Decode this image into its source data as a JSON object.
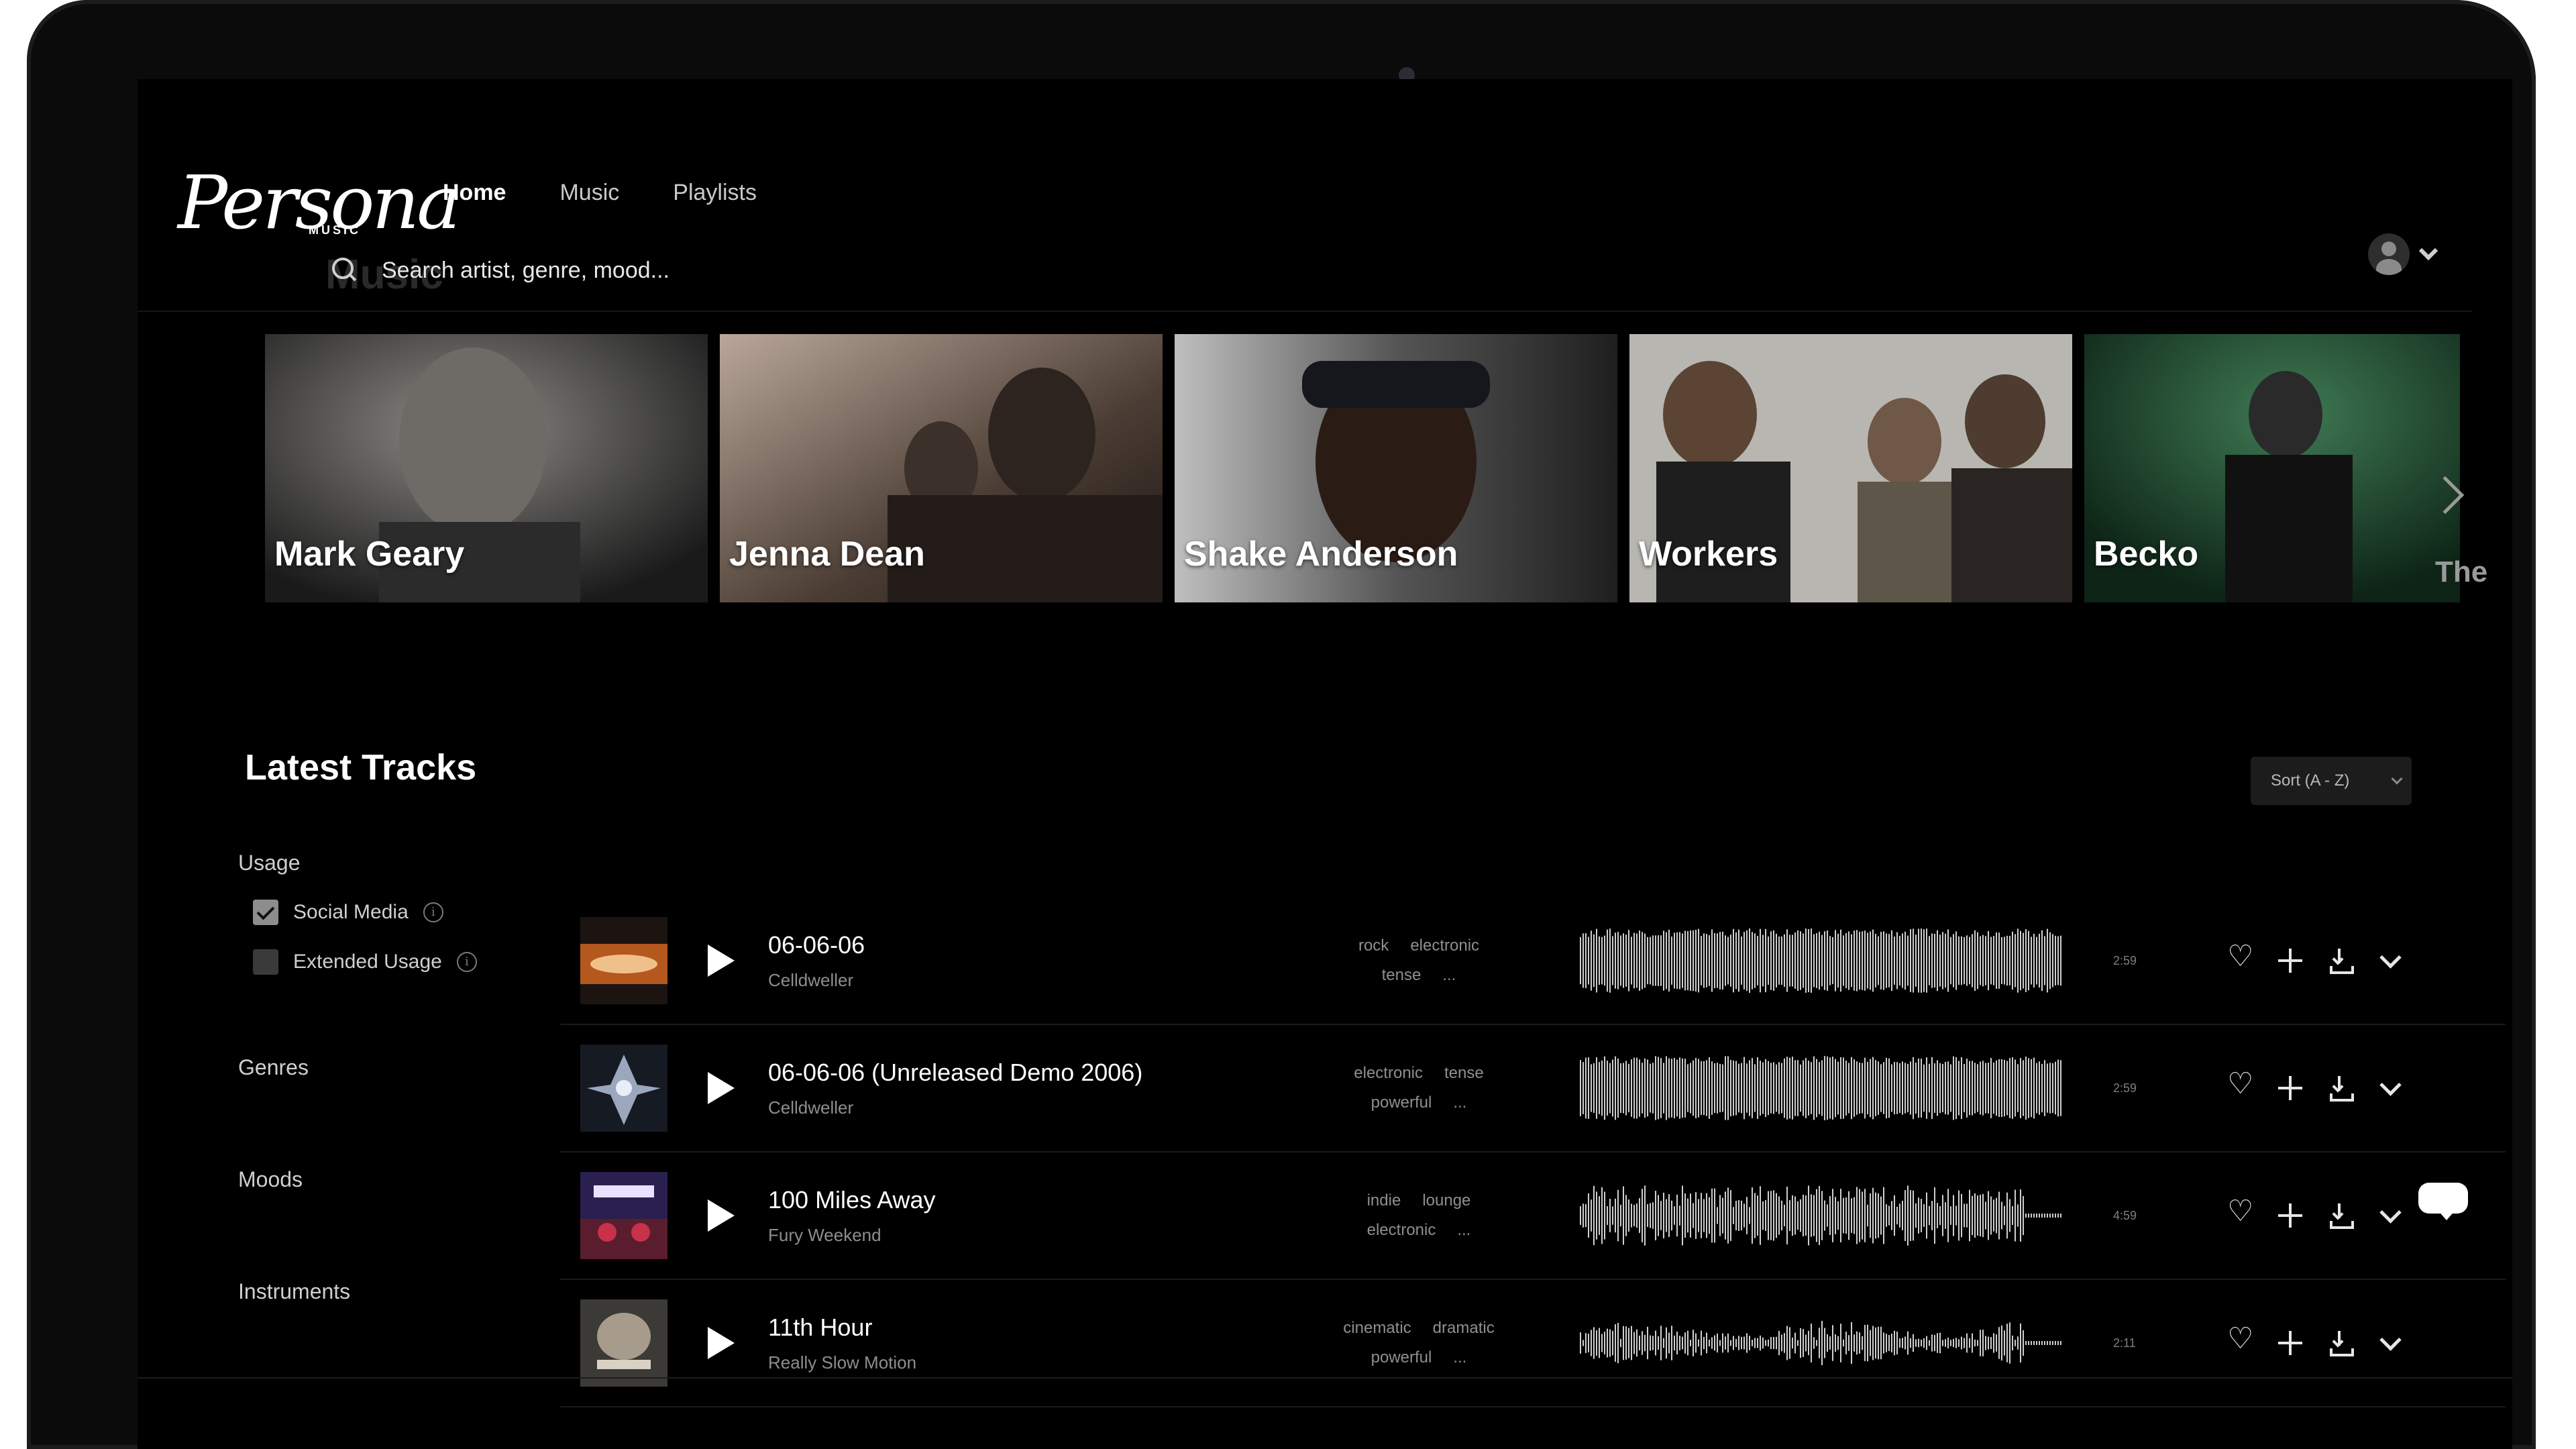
{
  "app": {
    "logo_text": "Persona",
    "logo_subtext": "MUSIC"
  },
  "nav": {
    "items": [
      {
        "label": "Home",
        "active": true
      },
      {
        "label": "Music",
        "active": false
      },
      {
        "label": "Playlists",
        "active": false
      }
    ]
  },
  "search": {
    "ghost_text": "Music",
    "placeholder": "Search artist, genre, mood..."
  },
  "artists": [
    {
      "name": "Mark Geary"
    },
    {
      "name": "Jenna Dean"
    },
    {
      "name": "Shake Anderson"
    },
    {
      "name": "Workers"
    },
    {
      "name": "Becko"
    }
  ],
  "artists_peek": "The",
  "latest": {
    "title": "Latest Tracks",
    "sort_label": "Sort (A - Z)"
  },
  "filters": {
    "usage_heading": "Usage",
    "usage_options": [
      {
        "label": "Social Media",
        "checked": true
      },
      {
        "label": "Extended Usage",
        "checked": false
      }
    ],
    "info_glyph": "i",
    "genres_heading": "Genres",
    "moods_heading": "Moods",
    "instruments_heading": "Instruments"
  },
  "tracks": [
    {
      "title": "06-06-06",
      "artist": "Celldweller",
      "tags_line1": [
        "rock",
        "electronic"
      ],
      "tags_line2": [
        "tense",
        "..."
      ],
      "duration": "2:59"
    },
    {
      "title": "06-06-06 (Unreleased Demo 2006)",
      "artist": "Celldweller",
      "tags_line1": [
        "electronic",
        "tense"
      ],
      "tags_line2": [
        "powerful",
        "..."
      ],
      "duration": "2:59"
    },
    {
      "title": "100 Miles Away",
      "artist": "Fury Weekend",
      "tags_line1": [
        "indie",
        "lounge"
      ],
      "tags_line2": [
        "electronic",
        "..."
      ],
      "duration": "4:59"
    },
    {
      "title": "11th Hour",
      "artist": "Really Slow Motion",
      "tags_line1": [
        "cinematic",
        "dramatic"
      ],
      "tags_line2": [
        "powerful",
        "..."
      ],
      "duration": "2:11"
    }
  ],
  "colors": {
    "background": "#000000",
    "text_primary": "#ffffff",
    "text_muted": "#8e8e8e",
    "bezel": "#0b0b0c"
  },
  "icons": {
    "search": "search-icon",
    "account": "user-icon",
    "play": "play-icon",
    "favorite": "heart-icon",
    "add": "plus-icon",
    "download": "download-icon",
    "expand": "chevron-down-icon",
    "chat": "chat-icon"
  }
}
